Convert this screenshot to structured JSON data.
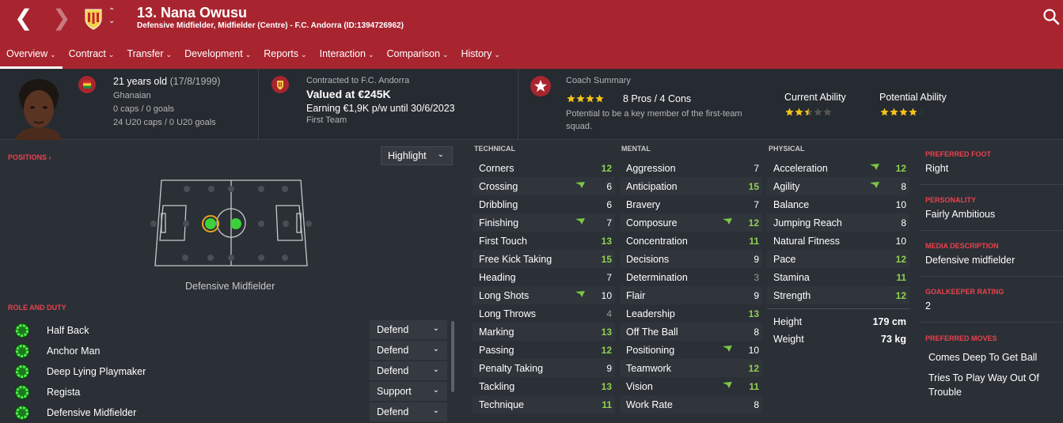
{
  "header": {
    "back_icon": "back-arrow-icon",
    "forward_icon": "forward-arrow-icon",
    "player_name": "13. Nana Owusu",
    "subtitle": "Defensive Midfielder, Midfielder (Centre) - F.C. Andorra (ID:1394726962)",
    "search_icon": "search-icon",
    "brand_color": "#a82530"
  },
  "tabs": [
    {
      "label": "Overview"
    },
    {
      "label": "Contract"
    },
    {
      "label": "Transfer"
    },
    {
      "label": "Development"
    },
    {
      "label": "Reports"
    },
    {
      "label": "Interaction"
    },
    {
      "label": "Comparison"
    },
    {
      "label": "History"
    }
  ],
  "profile": {
    "age": "21 years old",
    "dob": "(17/8/1999)",
    "nationality": "Ghanaian",
    "caps": "0 caps / 0 goals",
    "u20_caps": "24 U20 caps / 0 U20 goals"
  },
  "contract": {
    "label": "Contracted to F.C. Andorra",
    "value": "Valued at €245K",
    "earning": "Earning €1,9K p/w until 30/6/2023",
    "squad": "First Team"
  },
  "coach": {
    "title": "Coach Summary",
    "stars": 4,
    "pros_cons": "8 Pros / 4 Cons",
    "line1": "Potential to be a key member of the first-team",
    "line2": "squad.",
    "current_label": "Current Ability",
    "current_stars": 2.5,
    "potential_label": "Potential Ability",
    "potential_stars": 4
  },
  "positions": {
    "title": "POSITIONS",
    "dropdown": "Highlight",
    "caption": "Defensive Midfielder",
    "natural_color": "#3cd13c"
  },
  "roles": {
    "title": "ROLE AND DUTY",
    "items": [
      {
        "role": "Half Back",
        "duty": "Defend"
      },
      {
        "role": "Anchor Man",
        "duty": "Defend"
      },
      {
        "role": "Deep Lying Playmaker",
        "duty": "Defend"
      },
      {
        "role": "Regista",
        "duty": "Support"
      },
      {
        "role": "Defensive Midfielder",
        "duty": "Defend"
      }
    ]
  },
  "technical": {
    "title": "TECHNICAL",
    "rows": [
      {
        "name": "Corners",
        "value": "12",
        "arrow": false
      },
      {
        "name": "Crossing",
        "value": "6",
        "arrow": true
      },
      {
        "name": "Dribbling",
        "value": "6",
        "arrow": false
      },
      {
        "name": "Finishing",
        "value": "7",
        "arrow": true
      },
      {
        "name": "First Touch",
        "value": "13",
        "arrow": false
      },
      {
        "name": "Free Kick Taking",
        "value": "15",
        "arrow": false
      },
      {
        "name": "Heading",
        "value": "7",
        "arrow": false
      },
      {
        "name": "Long Shots",
        "value": "10",
        "arrow": true
      },
      {
        "name": "Long Throws",
        "value": "4",
        "arrow": false
      },
      {
        "name": "Marking",
        "value": "13",
        "arrow": false
      },
      {
        "name": "Passing",
        "value": "12",
        "arrow": false
      },
      {
        "name": "Penalty Taking",
        "value": "9",
        "arrow": false
      },
      {
        "name": "Tackling",
        "value": "13",
        "arrow": false
      },
      {
        "name": "Technique",
        "value": "11",
        "arrow": false
      }
    ]
  },
  "mental": {
    "title": "MENTAL",
    "rows": [
      {
        "name": "Aggression",
        "value": "7",
        "arrow": false
      },
      {
        "name": "Anticipation",
        "value": "15",
        "arrow": false
      },
      {
        "name": "Bravery",
        "value": "7",
        "arrow": false
      },
      {
        "name": "Composure",
        "value": "12",
        "arrow": true
      },
      {
        "name": "Concentration",
        "value": "11",
        "arrow": false
      },
      {
        "name": "Decisions",
        "value": "9",
        "arrow": false
      },
      {
        "name": "Determination",
        "value": "3",
        "arrow": false
      },
      {
        "name": "Flair",
        "value": "9",
        "arrow": false
      },
      {
        "name": "Leadership",
        "value": "13",
        "arrow": false
      },
      {
        "name": "Off The Ball",
        "value": "8",
        "arrow": false
      },
      {
        "name": "Positioning",
        "value": "10",
        "arrow": true
      },
      {
        "name": "Teamwork",
        "value": "12",
        "arrow": false
      },
      {
        "name": "Vision",
        "value": "11",
        "arrow": true
      },
      {
        "name": "Work Rate",
        "value": "8",
        "arrow": false
      }
    ]
  },
  "physical": {
    "title": "PHYSICAL",
    "rows": [
      {
        "name": "Acceleration",
        "value": "12",
        "arrow": true
      },
      {
        "name": "Agility",
        "value": "8",
        "arrow": true
      },
      {
        "name": "Balance",
        "value": "10",
        "arrow": false
      },
      {
        "name": "Jumping Reach",
        "value": "8",
        "arrow": false
      },
      {
        "name": "Natural Fitness",
        "value": "10",
        "arrow": false
      },
      {
        "name": "Pace",
        "value": "12",
        "arrow": false
      },
      {
        "name": "Stamina",
        "value": "11",
        "arrow": false
      },
      {
        "name": "Strength",
        "value": "12",
        "arrow": false
      }
    ],
    "height_label": "Height",
    "height": "179 cm",
    "weight_label": "Weight",
    "weight": "73 kg"
  },
  "side": {
    "foot_label": "PREFERRED FOOT",
    "foot": "Right",
    "personality_label": "PERSONALITY",
    "personality": "Fairly Ambitious",
    "media_label": "MEDIA DESCRIPTION",
    "media": "Defensive midfielder",
    "gk_label": "GOALKEEPER RATING",
    "gk": "2",
    "moves_label": "PREFERRED MOVES",
    "moves": [
      "Comes Deep To Get Ball",
      "Tries To Play Way Out Of Trouble"
    ]
  }
}
